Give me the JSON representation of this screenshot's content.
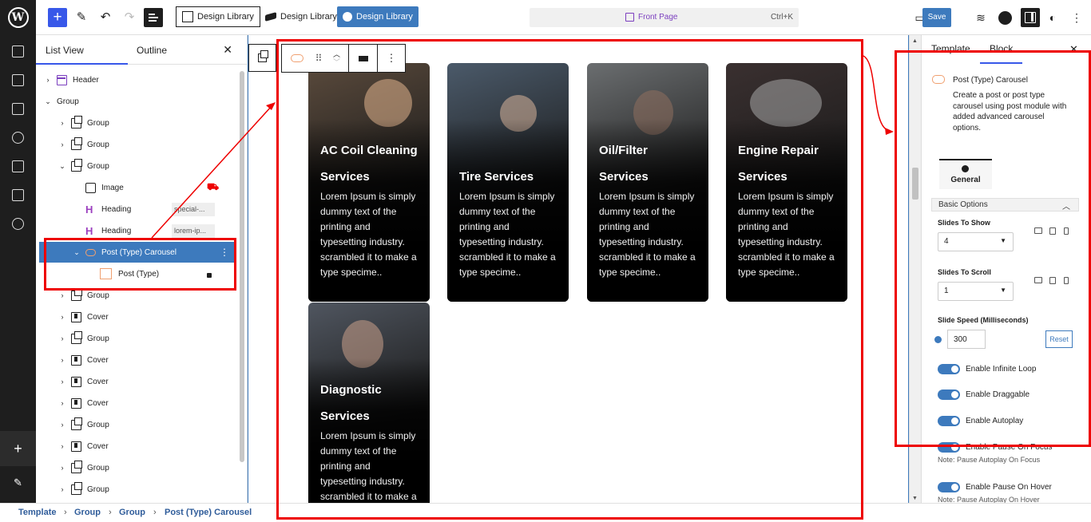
{
  "topbar": {
    "dl_outline_label": "Design Library",
    "dl_plain_label": "Design Library",
    "dl_blue_label": "Design Library",
    "command_title": "Front Page",
    "command_shortcut": "Ctrl+K",
    "save_label": "Save"
  },
  "listview": {
    "tab_list": "List View",
    "tab_outline": "Outline",
    "rows": [
      {
        "label": "Header"
      },
      {
        "label": "Group"
      },
      {
        "label": "Group"
      },
      {
        "label": "Group"
      },
      {
        "label": "Group"
      },
      {
        "label": "Image"
      },
      {
        "label": "Heading",
        "tag": "special-..."
      },
      {
        "label": "Heading",
        "tag": "lorem-ip..."
      },
      {
        "label": "Post (Type) Carousel"
      },
      {
        "label": "Post (Type)"
      },
      {
        "label": "Group"
      },
      {
        "label": "Cover"
      },
      {
        "label": "Group"
      },
      {
        "label": "Cover"
      },
      {
        "label": "Cover"
      },
      {
        "label": "Cover"
      },
      {
        "label": "Group"
      },
      {
        "label": "Cover"
      },
      {
        "label": "Group"
      },
      {
        "label": "Group"
      }
    ]
  },
  "cards": [
    {
      "title1": "AC Coil Cleaning",
      "title2": "Services",
      "desc": [
        "Lorem Ipsum is simply",
        "dummy text of the",
        "printing and",
        "typesetting industry.",
        "scrambled it to make a",
        "type specime.."
      ]
    },
    {
      "title1": "",
      "title2": "Tire Services",
      "desc": [
        "Lorem Ipsum is simply",
        "dummy text of the",
        "printing and",
        "typesetting industry.",
        "scrambled it to make a",
        "type specime.."
      ]
    },
    {
      "title1": "Oil/Filter",
      "title2": "Services",
      "desc": [
        "Lorem Ipsum is simply",
        "dummy text of the",
        "printing and",
        "typesetting industry.",
        "scrambled it to make a",
        "type specime.."
      ]
    },
    {
      "title1": "Engine Repair",
      "title2": "Services",
      "desc": [
        "Lorem Ipsum is simply",
        "dummy text of the",
        "printing and",
        "typesetting industry.",
        "scrambled it to make a",
        "type specime.."
      ]
    },
    {
      "title1": "Diagnostic",
      "title2": "Services",
      "desc": [
        "Lorem Ipsum is simply",
        "dummy text of the",
        "printing and",
        "typesetting industry.",
        "scrambled it to make a"
      ]
    }
  ],
  "sidebar": {
    "tab_template": "Template",
    "tab_block": "Block",
    "block_name": "Post (Type) Carousel",
    "block_desc": "Create a post or post type carousel using post module with added advanced carousel options.",
    "general_tab": "General",
    "basic_options": "Basic Options",
    "slides_to_show_label": "Slides To Show",
    "slides_to_show_value": "4",
    "slides_to_scroll_label": "Slides To Scroll",
    "slides_to_scroll_value": "1",
    "slide_speed_label": "Slide Speed (Milliseconds)",
    "slide_speed_value": "300",
    "reset_label": "Reset",
    "toggles": [
      {
        "label": "Enable Infinite Loop"
      },
      {
        "label": "Enable Draggable"
      },
      {
        "label": "Enable Autoplay"
      },
      {
        "label": "Enable Pause On Focus",
        "note": "Note: Pause Autoplay On Focus"
      },
      {
        "label": "Enable Pause On Hover",
        "note": "Note: Pause Autoplay On Hover"
      }
    ]
  },
  "breadcrumb": [
    "Template",
    "Group",
    "Group",
    "Post (Type) Carousel"
  ],
  "colors": {
    "accent": "#3d7abd",
    "wp_blue": "#3858e9",
    "highlight": "#e00000"
  }
}
